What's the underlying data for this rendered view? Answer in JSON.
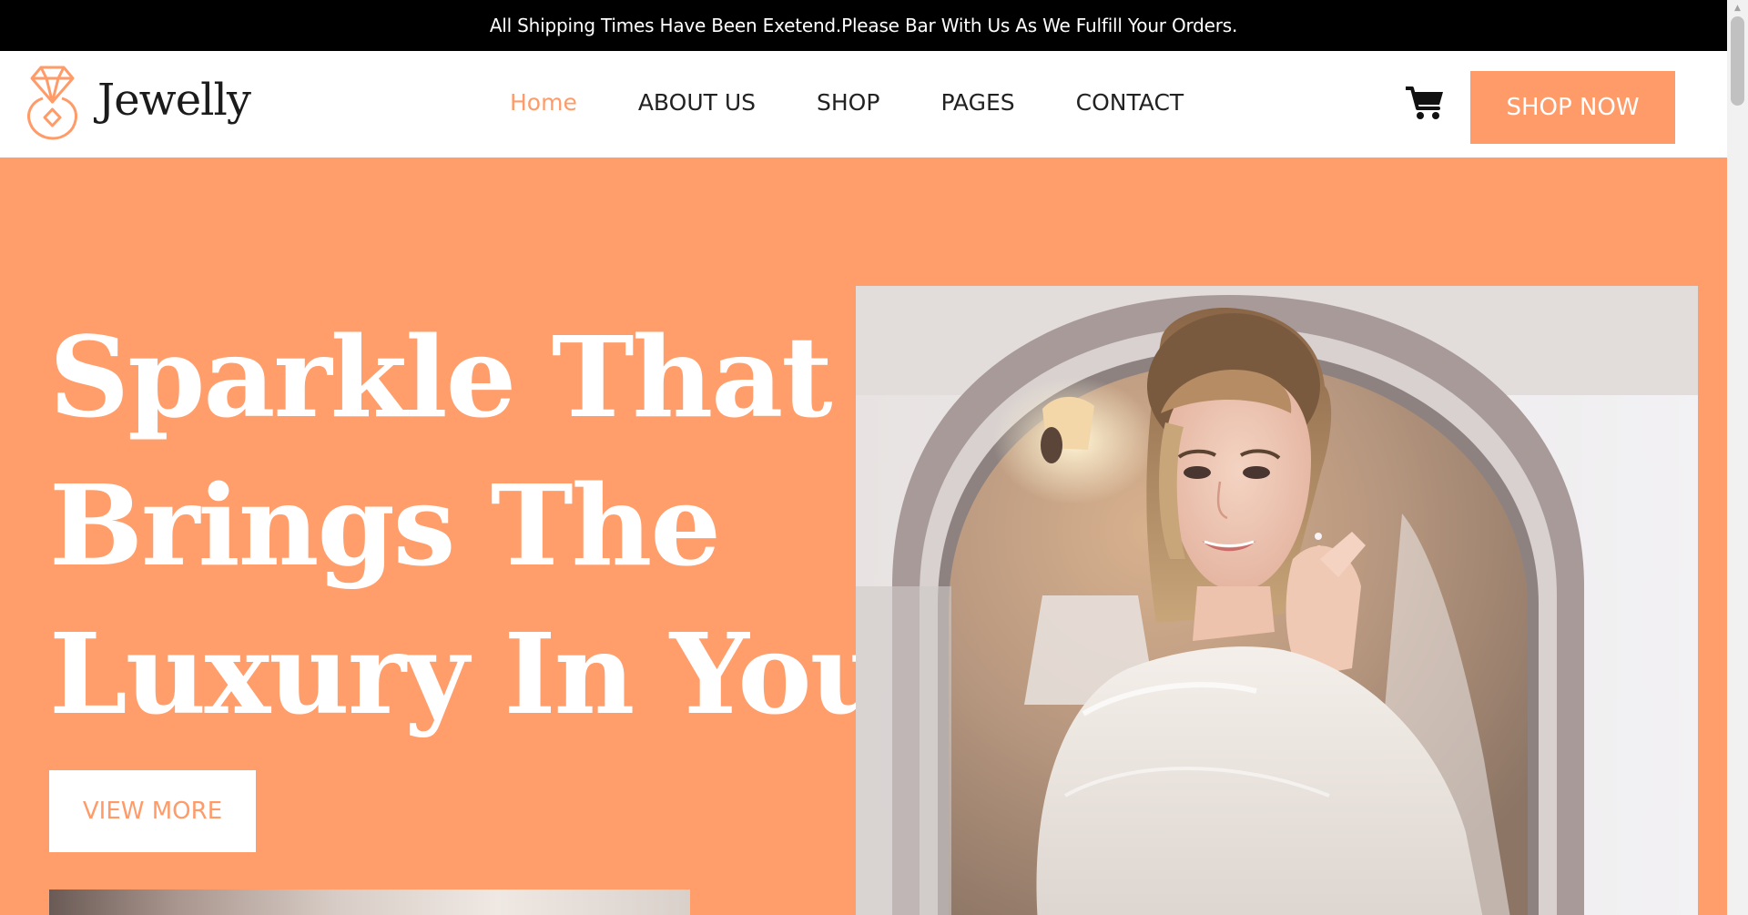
{
  "announcement": "All Shipping Times Have Been Exetend.Please Bar With Us As We Fulfill Your Orders.",
  "brand": {
    "name": "Jewelly",
    "accent_color": "#ff9b69",
    "hero_background": "#ff9d6b",
    "topbar_color": "#000000"
  },
  "nav": {
    "items": [
      {
        "label": "Home",
        "active": true
      },
      {
        "label": "ABOUT US",
        "active": false
      },
      {
        "label": "SHOP",
        "active": false
      },
      {
        "label": "PAGES",
        "active": false
      },
      {
        "label": "CONTACT",
        "active": false
      }
    ],
    "cart_icon": "cart-icon",
    "cta_label": "SHOP NOW"
  },
  "hero": {
    "title_lines": [
      "Sparkle That",
      "Brings The",
      "Luxury In You"
    ],
    "button_label": "VIEW MORE",
    "image": "woman-putting-on-earring-in-mirror"
  }
}
